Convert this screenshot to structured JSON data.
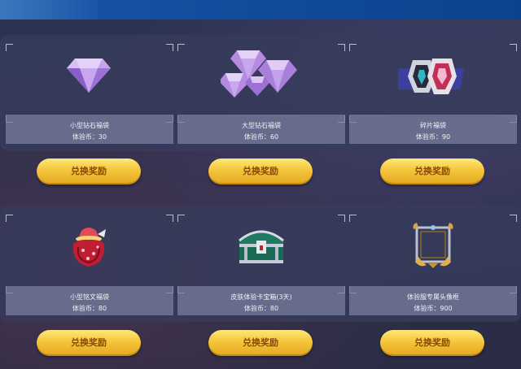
{
  "items": [
    {
      "name": "小型钻石福袋",
      "price": "体验币：30",
      "icon": "small-diamond-icon"
    },
    {
      "name": "大型钻石福袋",
      "price": "体验币：60",
      "icon": "diamonds-pile-icon"
    },
    {
      "name": "碎片福袋",
      "price": "体验币：90",
      "icon": "hero-fragments-icon"
    },
    {
      "name": "小型铭文福袋",
      "price": "体验币：80",
      "icon": "red-pouch-icon"
    },
    {
      "name": "皮肤体验卡宝箱(3天)",
      "price": "体验币：80",
      "icon": "treasure-chest-icon"
    },
    {
      "name": "体验服专属头像框",
      "price": "体验币：900",
      "icon": "avatar-frame-icon"
    }
  ],
  "redeem_label": "兑换奖励",
  "colors": {
    "button_gold": "#f5c53a",
    "button_text": "#8a4a06",
    "panel": "#373c5c",
    "topbar": "#0f4a98"
  }
}
